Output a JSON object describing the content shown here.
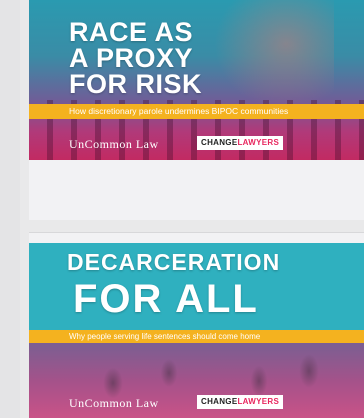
{
  "cards": [
    {
      "headline_lines": [
        "RACE AS",
        "A PROXY",
        "FOR RISK"
      ],
      "subtitle": "How discretionary parole undermines BIPOC communities",
      "logo_text": "UnCommon Law",
      "badge": {
        "prefix": "CHANGE",
        "suffix": "LAWYERS"
      }
    },
    {
      "headline_lines": [
        "DECARCERATION",
        "FOR ALL"
      ],
      "subtitle": "Why people serving life sentences should come home",
      "logo_text": "UnCommon Law",
      "badge": {
        "prefix": "CHANGE",
        "suffix": "LAWYERS"
      }
    }
  ],
  "colors": {
    "accent_yellow": "#f4b21f",
    "teal": "#2fb0bf",
    "magenta": "#c22a62",
    "badge_accent": "#e8265e"
  }
}
